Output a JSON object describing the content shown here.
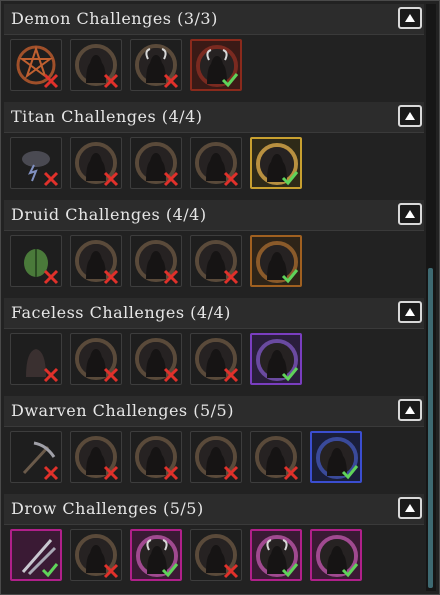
{
  "sections": [
    {
      "title": "Demon Challenges (3/3)",
      "collapse_icon": "chevron-up-icon",
      "tiles": [
        {
          "icon": "pentagram-icon",
          "status": "incomplete",
          "theme": "plain"
        },
        {
          "icon": "demon-head-icon",
          "status": "incomplete",
          "theme": "plain"
        },
        {
          "icon": "demon-horned-icon",
          "status": "incomplete",
          "theme": "plain"
        },
        {
          "icon": "demon-lord-icon",
          "status": "complete",
          "theme": "red"
        }
      ]
    },
    {
      "title": "Titan Challenges (4/4)",
      "collapse_icon": "chevron-up-icon",
      "tiles": [
        {
          "icon": "storm-cloud-icon",
          "status": "incomplete",
          "theme": "plain"
        },
        {
          "icon": "titan-silhouette-icon",
          "status": "incomplete",
          "theme": "plain"
        },
        {
          "icon": "titan-silhouette-icon",
          "status": "incomplete",
          "theme": "plain"
        },
        {
          "icon": "titan-silhouette-icon",
          "status": "incomplete",
          "theme": "plain"
        },
        {
          "icon": "titan-silhouette-icon",
          "status": "complete",
          "theme": "gold"
        }
      ]
    },
    {
      "title": "Druid Challenges (4/4)",
      "collapse_icon": "chevron-up-icon",
      "tiles": [
        {
          "icon": "leaf-icon",
          "status": "incomplete",
          "theme": "plain"
        },
        {
          "icon": "druid-silhouette-icon",
          "status": "incomplete",
          "theme": "plain"
        },
        {
          "icon": "druid-silhouette-icon",
          "status": "incomplete",
          "theme": "plain"
        },
        {
          "icon": "druid-silhouette-icon",
          "status": "incomplete",
          "theme": "plain"
        },
        {
          "icon": "druid-silhouette-icon",
          "status": "complete",
          "theme": "orange"
        }
      ]
    },
    {
      "title": "Faceless Challenges (4/4)",
      "collapse_icon": "chevron-up-icon",
      "tiles": [
        {
          "icon": "hooded-figure-icon",
          "status": "incomplete",
          "theme": "plain"
        },
        {
          "icon": "faceless-silhouette-icon",
          "status": "incomplete",
          "theme": "plain"
        },
        {
          "icon": "faceless-silhouette-icon",
          "status": "incomplete",
          "theme": "plain"
        },
        {
          "icon": "faceless-silhouette-icon",
          "status": "incomplete",
          "theme": "plain"
        },
        {
          "icon": "faceless-silhouette-icon",
          "status": "complete",
          "theme": "violet"
        }
      ]
    },
    {
      "title": "Dwarven Challenges (5/5)",
      "collapse_icon": "chevron-up-icon",
      "tiles": [
        {
          "icon": "pickaxe-icon",
          "status": "incomplete",
          "theme": "plain"
        },
        {
          "icon": "dwarf-silhouette-icon",
          "status": "incomplete",
          "theme": "plain"
        },
        {
          "icon": "dwarf-silhouette-icon",
          "status": "incomplete",
          "theme": "plain"
        },
        {
          "icon": "dwarf-silhouette-icon",
          "status": "incomplete",
          "theme": "plain"
        },
        {
          "icon": "dwarf-silhouette-icon",
          "status": "incomplete",
          "theme": "plain"
        },
        {
          "icon": "dwarf-silhouette-icon",
          "status": "complete",
          "theme": "blue"
        }
      ]
    },
    {
      "title": "Drow Challenges (5/5)",
      "collapse_icon": "chevron-up-icon",
      "tiles": [
        {
          "icon": "crossed-blades-icon",
          "status": "complete",
          "theme": "pink"
        },
        {
          "icon": "drow-silhouette-icon",
          "status": "incomplete",
          "theme": "plain"
        },
        {
          "icon": "drow-horned-icon",
          "status": "complete",
          "theme": "pink"
        },
        {
          "icon": "drow-silhouette-icon",
          "status": "incomplete",
          "theme": "plain"
        },
        {
          "icon": "drow-horned-icon",
          "status": "complete",
          "theme": "pink"
        },
        {
          "icon": "drow-silhouette-icon",
          "status": "complete",
          "theme": "pink"
        }
      ]
    }
  ],
  "colors": {
    "complete_check": "#5fd35a",
    "incomplete_cross": "#e0312b",
    "header_text": "#e6e6e6",
    "scrollbar": "#3e6a72"
  }
}
